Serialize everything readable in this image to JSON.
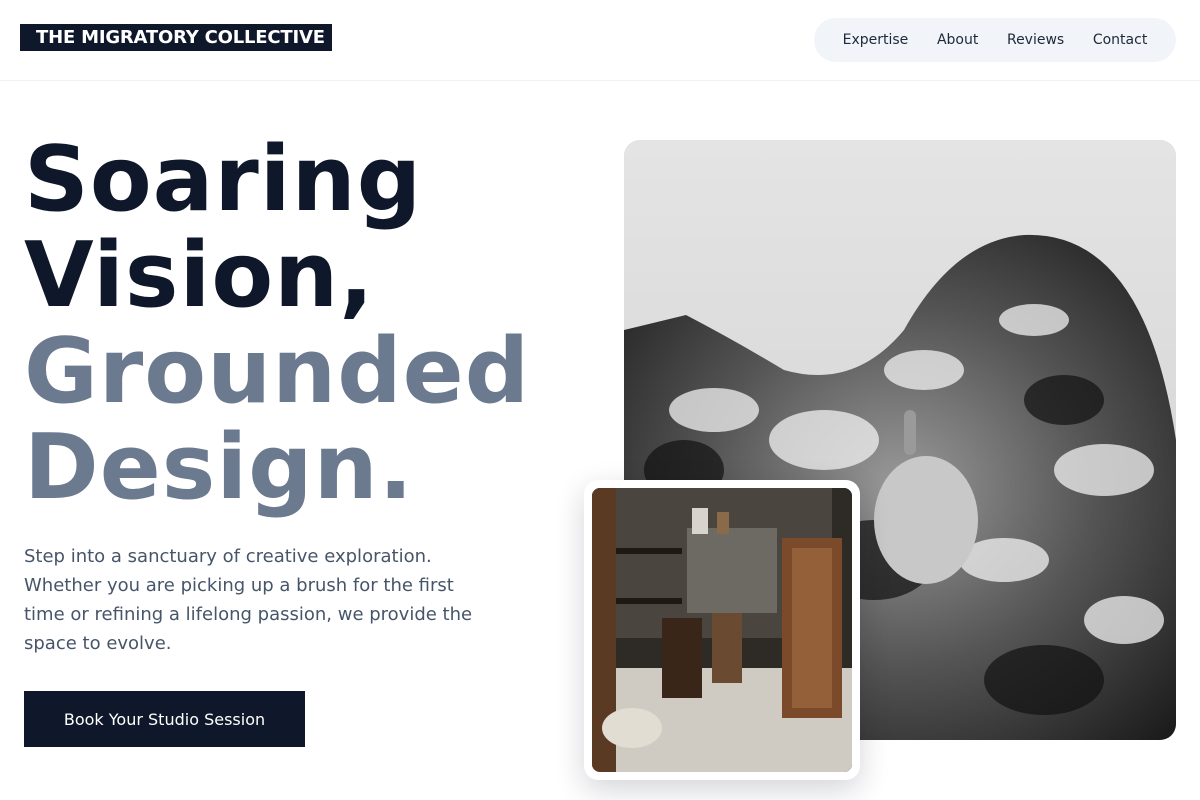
{
  "brand": {
    "name": "THE MIGRATORY COLLECTIVE"
  },
  "nav": {
    "items": [
      "Expertise",
      "About",
      "Reviews",
      "Contact"
    ]
  },
  "hero": {
    "headline_line1": "Soaring",
    "headline_line2": "Vision,",
    "headline_line3": "Grounded",
    "headline_line4": "Design.",
    "intro": "Step into a sanctuary of creative exploration. Whether you are picking up a brush for the first time or refining a lifelong passion, we provide the space to evolve.",
    "cta_label": "Book Your Studio Session"
  },
  "colors": {
    "primary": "#0f172a",
    "muted_heading": "#6b7a8f",
    "body_text": "#475569",
    "nav_bg": "#f1f4f8"
  }
}
